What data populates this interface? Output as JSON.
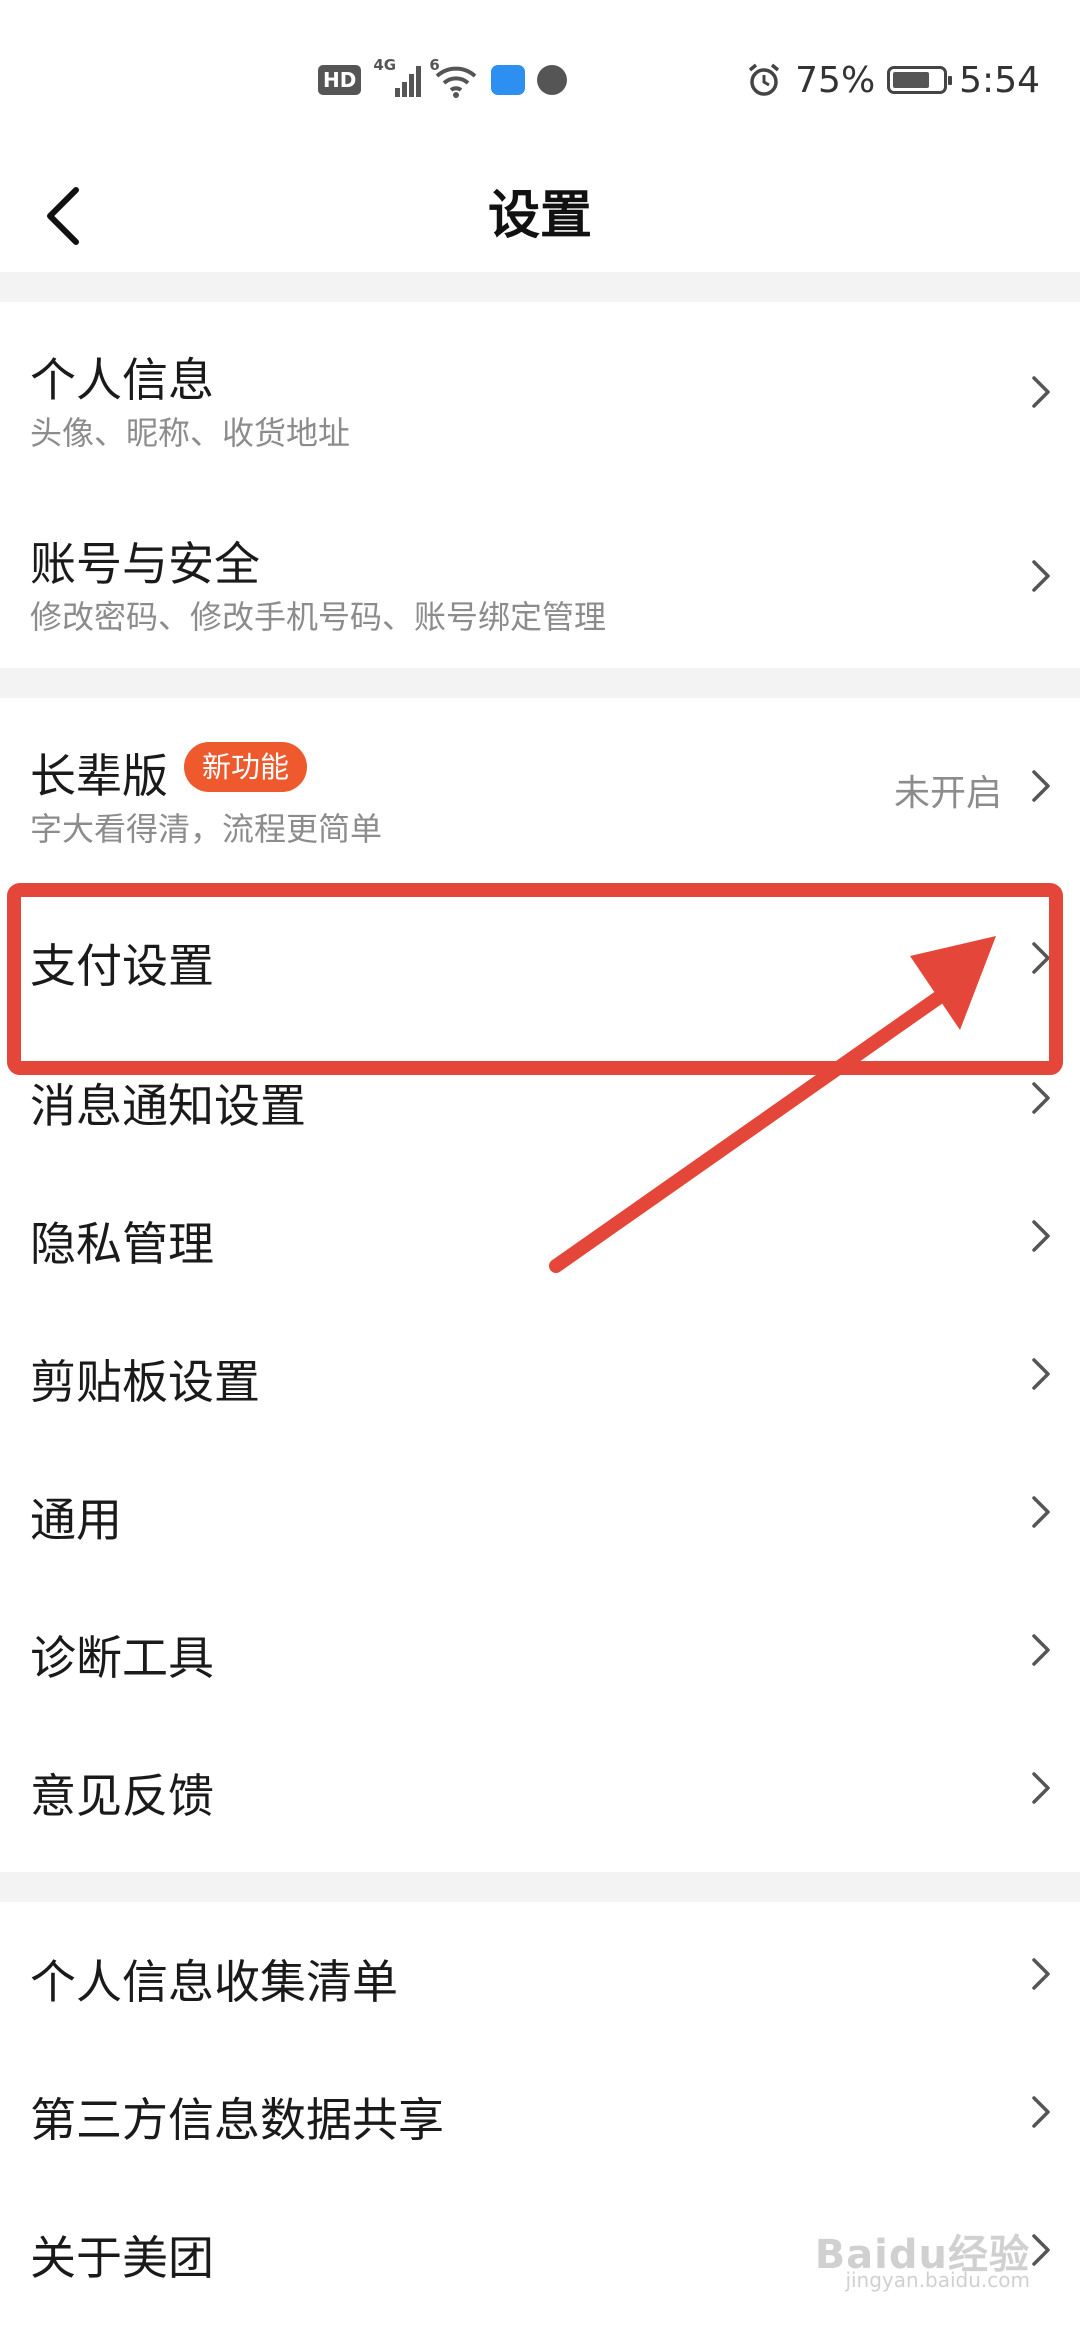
{
  "status_bar": {
    "hd": "HD",
    "network": "4G",
    "wifi_tag": "6",
    "battery_percent": "75%",
    "battery_level": 0.75,
    "time": "5:54"
  },
  "header": {
    "title": "设置",
    "back_icon": "chevron-left-icon"
  },
  "groups": [
    {
      "items": [
        {
          "label": "个人信息",
          "sub": "头像、昵称、收货地址"
        },
        {
          "label": "账号与安全",
          "sub": "修改密码、修改手机号码、账号绑定管理"
        }
      ]
    },
    {
      "items": [
        {
          "label": "长辈版",
          "badge": "新功能",
          "sub": "字大看得清，流程更简单",
          "value": "未开启"
        },
        {
          "label": "支付设置"
        },
        {
          "label": "消息通知设置"
        },
        {
          "label": "隐私管理"
        },
        {
          "label": "剪贴板设置"
        },
        {
          "label": "通用"
        },
        {
          "label": "诊断工具"
        },
        {
          "label": "意见反馈"
        }
      ]
    },
    {
      "items": [
        {
          "label": "个人信息收集清单"
        },
        {
          "label": "第三方信息数据共享"
        },
        {
          "label": "关于美团"
        }
      ]
    }
  ],
  "annotation": {
    "highlight_color": "#e5463a",
    "highlighted_item": "支付设置"
  },
  "watermark": {
    "text": "Baidu经验",
    "sub": "jingyan.baidu.com"
  },
  "colors": {
    "accent_badge": "#ee5a2e",
    "section_gap": "#f3f3f3",
    "secondary_text": "#8c8c8c"
  }
}
